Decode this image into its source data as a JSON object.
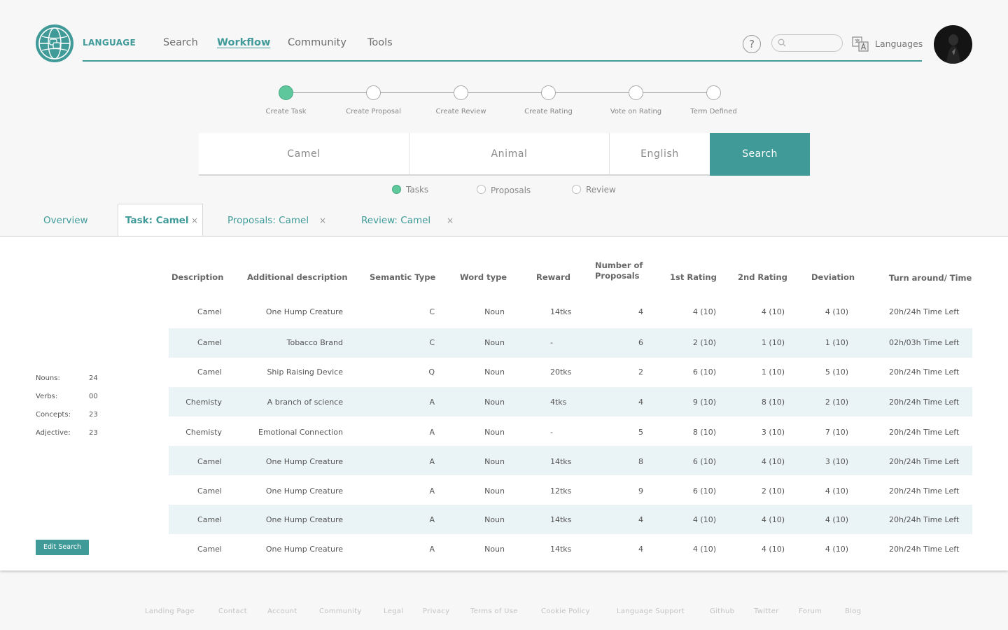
{
  "header": {
    "brand": "LANGUAGE",
    "nav": [
      {
        "label": "Search",
        "active": false
      },
      {
        "label": "Workflow",
        "active": true
      },
      {
        "label": "Community",
        "active": false
      },
      {
        "label": "Tools",
        "active": false
      }
    ],
    "help_label": "?",
    "search_placeholder": "",
    "languages_label": "Languages",
    "accent_color": "#3f9a98"
  },
  "stepper": {
    "steps": [
      {
        "label": "Create Task",
        "done": true
      },
      {
        "label": "Create Proposal",
        "done": false
      },
      {
        "label": "Create Review",
        "done": false
      },
      {
        "label": "Create Rating",
        "done": false
      },
      {
        "label": "Vote on Rating",
        "done": false
      },
      {
        "label": "Term Defined",
        "done": false
      }
    ]
  },
  "search": {
    "term": "Camel",
    "category": "Animal",
    "language": "English",
    "button": "Search"
  },
  "filters": [
    {
      "label": "Tasks",
      "selected": true
    },
    {
      "label": "Proposals",
      "selected": false
    },
    {
      "label": "Review",
      "selected": false
    }
  ],
  "tabs": [
    {
      "label": "Overview",
      "closable": false,
      "active": false
    },
    {
      "label": "Task: Camel",
      "closable": true,
      "active": true
    },
    {
      "label": "Proposals: Camel",
      "closable": true,
      "active": false
    },
    {
      "label": "Review: Camel",
      "closable": true,
      "active": false
    }
  ],
  "close_glyph": "×",
  "stats": [
    {
      "label": "Nouns:",
      "value": "24"
    },
    {
      "label": "Verbs:",
      "value": "00"
    },
    {
      "label": "Concepts:",
      "value": "23"
    },
    {
      "label": "Adjective:",
      "value": "23"
    }
  ],
  "edit_button": "Edit Search",
  "table": {
    "headers": {
      "description": "Description",
      "additional": "Additional description",
      "semantic": "Semantic Type",
      "word_type": "Word type",
      "reward": "Reward",
      "proposals_1": "Number of",
      "proposals_2": "Proposals",
      "rating1": "1st Rating",
      "rating2": "2nd Rating",
      "deviation": "Deviation",
      "turnaround": "Turn around/ Time"
    },
    "rows": [
      {
        "desc": "Camel",
        "add": "One Hump Creature",
        "sem": "C",
        "word": "Noun",
        "reward": "14tks",
        "num": "4",
        "r1": "4 (10)",
        "r2": "4 (10)",
        "dev": "4 (10)",
        "time": "20h/24h Time Left"
      },
      {
        "desc": "Camel",
        "add": "Tobacco Brand",
        "sem": "C",
        "word": "Noun",
        "reward": "-",
        "num": "6",
        "r1": "2 (10)",
        "r2": "1 (10)",
        "dev": "1 (10)",
        "time": "02h/03h Time Left"
      },
      {
        "desc": "Camel",
        "add": "Ship Raising Device",
        "sem": "Q",
        "word": "Noun",
        "reward": "20tks",
        "num": "2",
        "r1": "6 (10)",
        "r2": "1 (10)",
        "dev": "5 (10)",
        "time": "20h/24h Time Left"
      },
      {
        "desc": "Chemisty",
        "add": "A branch of science",
        "sem": "A",
        "word": "Noun",
        "reward": "4tks",
        "num": "4",
        "r1": "9 (10)",
        "r2": "8 (10)",
        "dev": "2 (10)",
        "time": "20h/24h Time Left"
      },
      {
        "desc": "Chemisty",
        "add": "Emotional Connection",
        "sem": "A",
        "word": "Noun",
        "reward": "-",
        "num": "5",
        "r1": "8 (10)",
        "r2": "3 (10)",
        "dev": "7 (10)",
        "time": "20h/24h Time Left"
      },
      {
        "desc": "Camel",
        "add": "One Hump Creature",
        "sem": "A",
        "word": "Noun",
        "reward": "14tks",
        "num": "8",
        "r1": "6 (10)",
        "r2": "4 (10)",
        "dev": "3 (10)",
        "time": "20h/24h Time Left"
      },
      {
        "desc": "Camel",
        "add": "One Hump Creature",
        "sem": "A",
        "word": "Noun",
        "reward": "12tks",
        "num": "9",
        "r1": "6 (10)",
        "r2": "2 (10)",
        "dev": "4 (10)",
        "time": "20h/24h Time Left"
      },
      {
        "desc": "Camel",
        "add": "One Hump Creature",
        "sem": "A",
        "word": "Noun",
        "reward": "14tks",
        "num": "4",
        "r1": "4 (10)",
        "r2": "4 (10)",
        "dev": "4 (10)",
        "time": "20h/24h Time Left"
      },
      {
        "desc": "Camel",
        "add": "One Hump Creature",
        "sem": "A",
        "word": "Noun",
        "reward": "14tks",
        "num": "4",
        "r1": "4 (10)",
        "r2": "4 (10)",
        "dev": "4 (10)",
        "time": "20h/24h Time Left"
      }
    ]
  },
  "footer": [
    "Landing Page",
    "Contact",
    "Account",
    "Community",
    "Legal",
    "Privacy",
    "Terms of Use",
    "Cookie Policy",
    "Language Support",
    "Github",
    "Twitter",
    "Forum",
    "Blog"
  ]
}
